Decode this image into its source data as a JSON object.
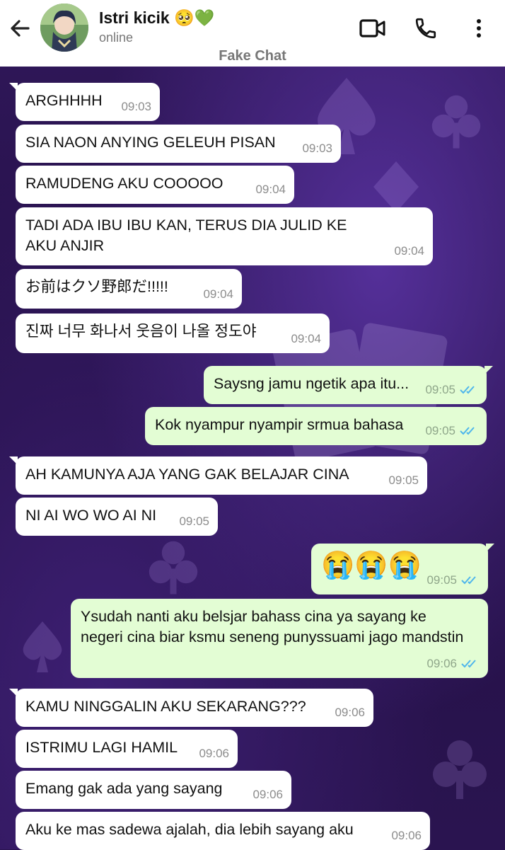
{
  "header": {
    "contact_name": "Istri kicik 🥺💚",
    "status": "online",
    "watermark": "Fake Chat"
  },
  "messages": [
    {
      "dir": "in",
      "text": "ARGHHHH",
      "time": "09:03"
    },
    {
      "dir": "in",
      "text": "SIA NAON ANYING GELEUH PISAN",
      "time": "09:03"
    },
    {
      "dir": "in",
      "text": "RAMUDENG AKU COOOOO",
      "time": "09:04"
    },
    {
      "dir": "in",
      "text": "TADI ADA IBU IBU KAN, TERUS DIA JULID KE AKU ANJIR",
      "time": "09:04"
    },
    {
      "dir": "in",
      "text": "お前はクソ野郎だ!!!!!",
      "time": "09:04"
    },
    {
      "dir": "in",
      "text": "진짜 너무 화나서 웃음이 나올 정도야",
      "time": "09:04"
    },
    {
      "dir": "out",
      "text": "Saysng jamu ngetik apa itu...",
      "time": "09:05"
    },
    {
      "dir": "out",
      "text": "Kok nyampur nyampir srmua bahasa",
      "time": "09:05"
    },
    {
      "dir": "in",
      "text": "AH KAMUNYA AJA YANG GAK BELAJAR CINA",
      "time": "09:05"
    },
    {
      "dir": "in",
      "text": "NI AI WO WO AI NI",
      "time": "09:05"
    },
    {
      "dir": "out",
      "text": "😭😭😭",
      "time": "09:05"
    },
    {
      "dir": "out",
      "text": "Ysudah nanti aku belsjar bahass cina ya sayang ke negeri cina biar ksmu seneng punyssuami jago mandstin",
      "time": "09:06"
    },
    {
      "dir": "in",
      "text": "KAMU NINGGALIN AKU SEKARANG???",
      "time": "09:06"
    },
    {
      "dir": "in",
      "text": "ISTRIMU LAGI HAMIL",
      "time": "09:06"
    },
    {
      "dir": "in",
      "text": "Emang gak ada yang sayang",
      "time": "09:06"
    },
    {
      "dir": "in",
      "text": "Aku ke mas sadewa ajalah, dia lebih sayang aku",
      "time": "09:06"
    }
  ],
  "icons": {
    "back": "arrow-left-icon",
    "video": "video-call-icon",
    "phone": "phone-icon",
    "menu": "more-vertical-icon",
    "read": "double-check-icon"
  },
  "colors": {
    "incoming_bubble": "#ffffff",
    "outgoing_bubble": "#e3fdd4",
    "read_tick": "#4fb6ec"
  }
}
